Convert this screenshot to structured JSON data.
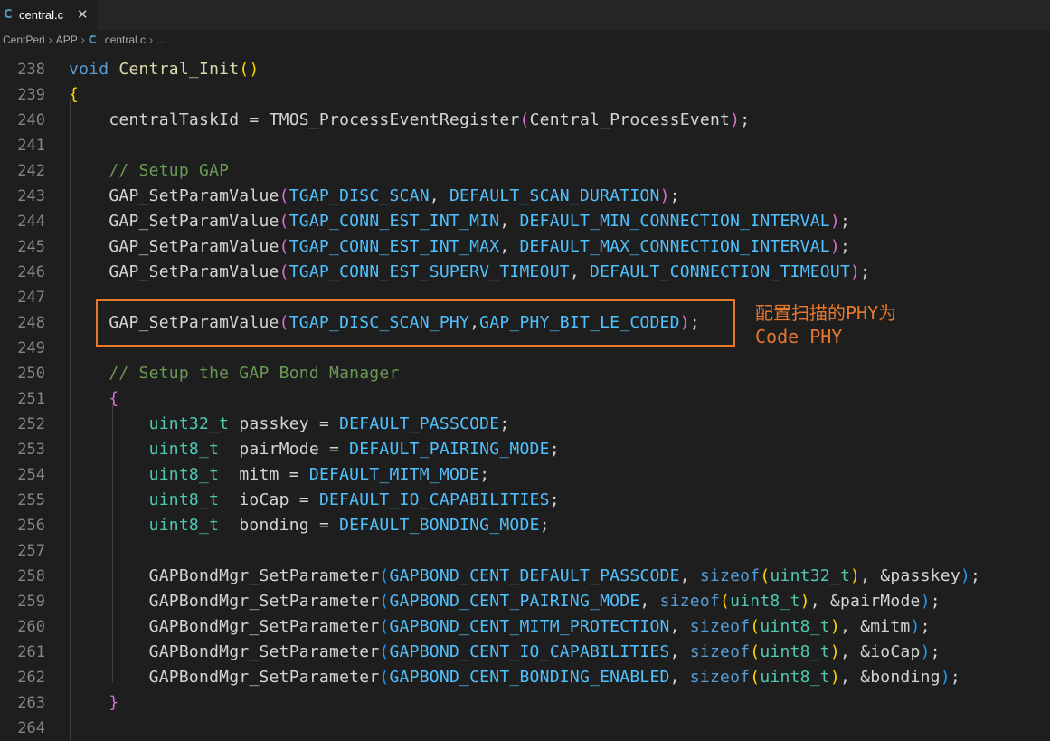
{
  "tab": {
    "icon": "c-file-icon",
    "label": "central.c",
    "close": "✕"
  },
  "breadcrumb": {
    "items": [
      "CentPeri",
      "APP",
      "central.c",
      "..."
    ]
  },
  "annotation": {
    "line1": "配置扫描的PHY为",
    "line2": "Code PHY"
  },
  "lines": [
    {
      "n": "238",
      "tokens": [
        [
          "void",
          "kw"
        ],
        [
          " ",
          ""
        ],
        [
          "Central_Init",
          "fn"
        ],
        [
          "(",
          "p1"
        ],
        [
          ")",
          "p1"
        ]
      ]
    },
    {
      "n": "239",
      "tokens": [
        [
          "{",
          "p1"
        ]
      ]
    },
    {
      "n": "240",
      "tokens": [
        [
          "    ",
          ""
        ],
        [
          "centralTaskId",
          "var"
        ],
        [
          " = ",
          ""
        ],
        [
          "TMOS_ProcessEventRegister",
          "var"
        ],
        [
          "(",
          "p2"
        ],
        [
          "Central_ProcessEvent",
          "var"
        ],
        [
          ")",
          "p2"
        ],
        [
          ";",
          ""
        ]
      ]
    },
    {
      "n": "241",
      "tokens": []
    },
    {
      "n": "242",
      "tokens": [
        [
          "    ",
          ""
        ],
        [
          "// Setup GAP",
          "cmt"
        ]
      ]
    },
    {
      "n": "243",
      "tokens": [
        [
          "    ",
          ""
        ],
        [
          "GAP_SetParamValue",
          "var"
        ],
        [
          "(",
          "p2"
        ],
        [
          "TGAP_DISC_SCAN",
          "const"
        ],
        [
          ", ",
          ""
        ],
        [
          "DEFAULT_SCAN_DURATION",
          "const"
        ],
        [
          ")",
          "p2"
        ],
        [
          ";",
          ""
        ]
      ]
    },
    {
      "n": "244",
      "tokens": [
        [
          "    ",
          ""
        ],
        [
          "GAP_SetParamValue",
          "var"
        ],
        [
          "(",
          "p2"
        ],
        [
          "TGAP_CONN_EST_INT_MIN",
          "const"
        ],
        [
          ", ",
          ""
        ],
        [
          "DEFAULT_MIN_CONNECTION_INTERVAL",
          "const"
        ],
        [
          ")",
          "p2"
        ],
        [
          ";",
          ""
        ]
      ]
    },
    {
      "n": "245",
      "tokens": [
        [
          "    ",
          ""
        ],
        [
          "GAP_SetParamValue",
          "var"
        ],
        [
          "(",
          "p2"
        ],
        [
          "TGAP_CONN_EST_INT_MAX",
          "const"
        ],
        [
          ", ",
          ""
        ],
        [
          "DEFAULT_MAX_CONNECTION_INTERVAL",
          "const"
        ],
        [
          ")",
          "p2"
        ],
        [
          ";",
          ""
        ]
      ]
    },
    {
      "n": "246",
      "tokens": [
        [
          "    ",
          ""
        ],
        [
          "GAP_SetParamValue",
          "var"
        ],
        [
          "(",
          "p2"
        ],
        [
          "TGAP_CONN_EST_SUPERV_TIMEOUT",
          "const"
        ],
        [
          ", ",
          ""
        ],
        [
          "DEFAULT_CONNECTION_TIMEOUT",
          "const"
        ],
        [
          ")",
          "p2"
        ],
        [
          ";",
          ""
        ]
      ]
    },
    {
      "n": "247",
      "tokens": []
    },
    {
      "n": "248",
      "tokens": [
        [
          "    ",
          ""
        ],
        [
          "GAP_SetParamValue",
          "var"
        ],
        [
          "(",
          "p2"
        ],
        [
          "TGAP_DISC_SCAN_PHY",
          "const"
        ],
        [
          ",",
          ""
        ],
        [
          "GAP_PHY_BIT_LE_CODED",
          "const"
        ],
        [
          ")",
          "p2"
        ],
        [
          ";",
          ""
        ]
      ]
    },
    {
      "n": "249",
      "tokens": []
    },
    {
      "n": "250",
      "tokens": [
        [
          "    ",
          ""
        ],
        [
          "// Setup the GAP Bond Manager",
          "cmt"
        ]
      ]
    },
    {
      "n": "251",
      "tokens": [
        [
          "    ",
          ""
        ],
        [
          "{",
          "p2"
        ]
      ]
    },
    {
      "n": "252",
      "tokens": [
        [
          "        ",
          ""
        ],
        [
          "uint32_t",
          "type"
        ],
        [
          " passkey = ",
          ""
        ],
        [
          "DEFAULT_PASSCODE",
          "const"
        ],
        [
          ";",
          ""
        ]
      ]
    },
    {
      "n": "253",
      "tokens": [
        [
          "        ",
          ""
        ],
        [
          "uint8_t",
          "type"
        ],
        [
          "  pairMode = ",
          ""
        ],
        [
          "DEFAULT_PAIRING_MODE",
          "const"
        ],
        [
          ";",
          ""
        ]
      ]
    },
    {
      "n": "254",
      "tokens": [
        [
          "        ",
          ""
        ],
        [
          "uint8_t",
          "type"
        ],
        [
          "  mitm = ",
          ""
        ],
        [
          "DEFAULT_MITM_MODE",
          "const"
        ],
        [
          ";",
          ""
        ]
      ]
    },
    {
      "n": "255",
      "tokens": [
        [
          "        ",
          ""
        ],
        [
          "uint8_t",
          "type"
        ],
        [
          "  ioCap = ",
          ""
        ],
        [
          "DEFAULT_IO_CAPABILITIES",
          "const"
        ],
        [
          ";",
          ""
        ]
      ]
    },
    {
      "n": "256",
      "tokens": [
        [
          "        ",
          ""
        ],
        [
          "uint8_t",
          "type"
        ],
        [
          "  bonding = ",
          ""
        ],
        [
          "DEFAULT_BONDING_MODE",
          "const"
        ],
        [
          ";",
          ""
        ]
      ]
    },
    {
      "n": "257",
      "tokens": []
    },
    {
      "n": "258",
      "tokens": [
        [
          "        ",
          ""
        ],
        [
          "GAPBondMgr_SetParameter",
          "var"
        ],
        [
          "(",
          "p3"
        ],
        [
          "GAPBOND_CENT_DEFAULT_PASSCODE",
          "const"
        ],
        [
          ", ",
          ""
        ],
        [
          "sizeof",
          "kw"
        ],
        [
          "(",
          "p1"
        ],
        [
          "uint32_t",
          "type"
        ],
        [
          ")",
          "p1"
        ],
        [
          ", &passkey",
          ""
        ],
        [
          ")",
          "p3"
        ],
        [
          ";",
          ""
        ]
      ]
    },
    {
      "n": "259",
      "tokens": [
        [
          "        ",
          ""
        ],
        [
          "GAPBondMgr_SetParameter",
          "var"
        ],
        [
          "(",
          "p3"
        ],
        [
          "GAPBOND_CENT_PAIRING_MODE",
          "const"
        ],
        [
          ", ",
          ""
        ],
        [
          "sizeof",
          "kw"
        ],
        [
          "(",
          "p1"
        ],
        [
          "uint8_t",
          "type"
        ],
        [
          ")",
          "p1"
        ],
        [
          ", &pairMode",
          ""
        ],
        [
          ")",
          "p3"
        ],
        [
          ";",
          ""
        ]
      ]
    },
    {
      "n": "260",
      "tokens": [
        [
          "        ",
          ""
        ],
        [
          "GAPBondMgr_SetParameter",
          "var"
        ],
        [
          "(",
          "p3"
        ],
        [
          "GAPBOND_CENT_MITM_PROTECTION",
          "const"
        ],
        [
          ", ",
          ""
        ],
        [
          "sizeof",
          "kw"
        ],
        [
          "(",
          "p1"
        ],
        [
          "uint8_t",
          "type"
        ],
        [
          ")",
          "p1"
        ],
        [
          ", &mitm",
          ""
        ],
        [
          ")",
          "p3"
        ],
        [
          ";",
          ""
        ]
      ]
    },
    {
      "n": "261",
      "tokens": [
        [
          "        ",
          ""
        ],
        [
          "GAPBondMgr_SetParameter",
          "var"
        ],
        [
          "(",
          "p3"
        ],
        [
          "GAPBOND_CENT_IO_CAPABILITIES",
          "const"
        ],
        [
          ", ",
          ""
        ],
        [
          "sizeof",
          "kw"
        ],
        [
          "(",
          "p1"
        ],
        [
          "uint8_t",
          "type"
        ],
        [
          ")",
          "p1"
        ],
        [
          ", &ioCap",
          ""
        ],
        [
          ")",
          "p3"
        ],
        [
          ";",
          ""
        ]
      ]
    },
    {
      "n": "262",
      "tokens": [
        [
          "        ",
          ""
        ],
        [
          "GAPBondMgr_SetParameter",
          "var"
        ],
        [
          "(",
          "p3"
        ],
        [
          "GAPBOND_CENT_BONDING_ENABLED",
          "const"
        ],
        [
          ", ",
          ""
        ],
        [
          "sizeof",
          "kw"
        ],
        [
          "(",
          "p1"
        ],
        [
          "uint8_t",
          "type"
        ],
        [
          ")",
          "p1"
        ],
        [
          ", &bonding",
          ""
        ],
        [
          ")",
          "p3"
        ],
        [
          ";",
          ""
        ]
      ]
    },
    {
      "n": "263",
      "tokens": [
        [
          "    ",
          ""
        ],
        [
          "}",
          "p2"
        ]
      ]
    },
    {
      "n": "264",
      "tokens": []
    }
  ]
}
